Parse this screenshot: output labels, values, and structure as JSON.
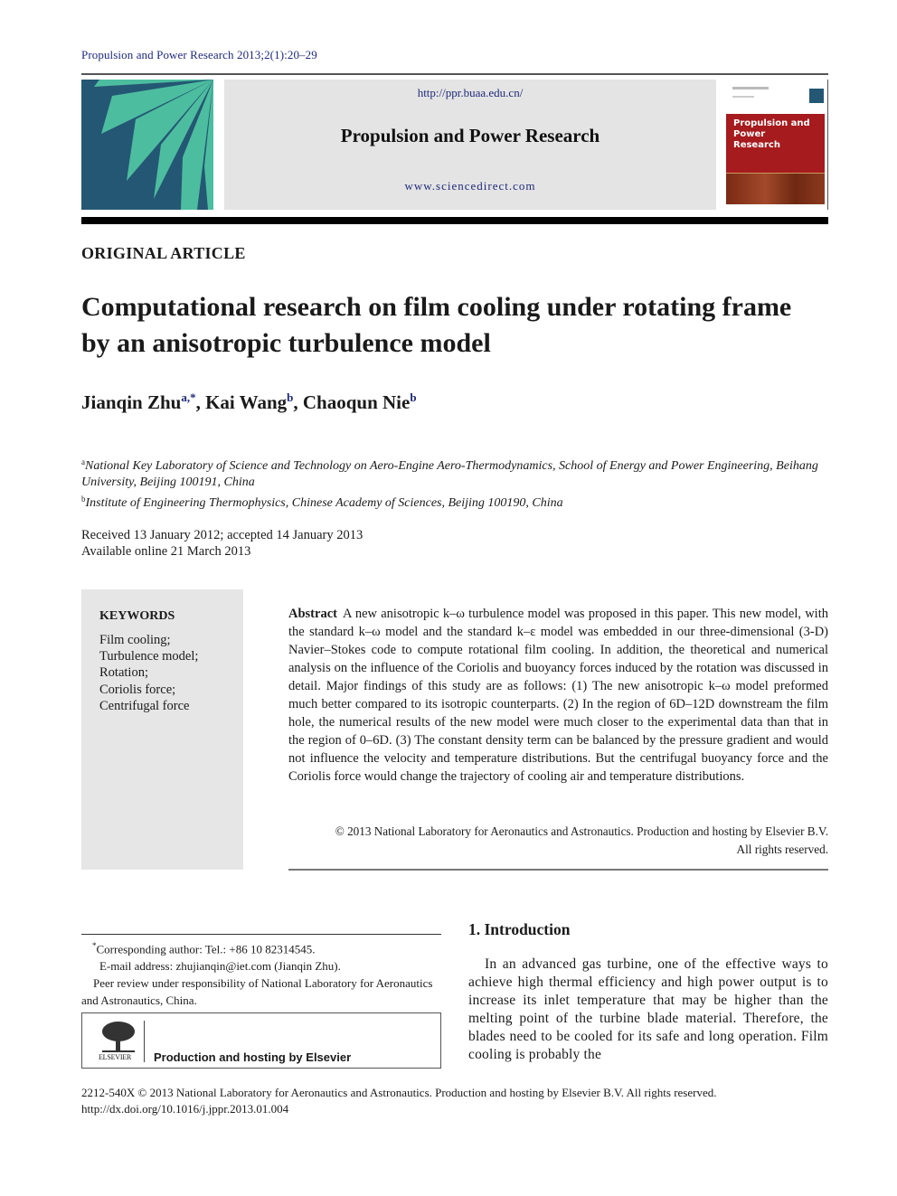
{
  "journal_reference": "Propulsion and Power Research 2013;2(1):20–29",
  "banner": {
    "url_top": "http://ppr.buaa.edu.cn/",
    "journal_name": "Propulsion and Power Research",
    "url_bottom": "www.sciencedirect.com"
  },
  "cover": {
    "title_line1": "Propulsion and",
    "title_line2": "Power",
    "title_line3": "Research",
    "accent_color": "#a61b1e"
  },
  "logo_colors": {
    "background": "#245774",
    "rays": "#4dbd9f"
  },
  "article_type": "ORIGINAL ARTICLE",
  "title": "Computational research on film cooling under rotating frame by an anisotropic turbulence model",
  "authors": [
    {
      "name": "Jianqin Zhu",
      "sup": "a,*",
      "sep": ", "
    },
    {
      "name": "Kai Wang",
      "sup": "b",
      "sep": ", "
    },
    {
      "name": "Chaoqun Nie",
      "sup": "b",
      "sep": ""
    }
  ],
  "affiliations": [
    {
      "mark": "a",
      "text": "National Key Laboratory of Science and Technology on Aero-Engine Aero-Thermodynamics, School of Energy and Power Engineering, Beihang University, Beijing 100191, China"
    },
    {
      "mark": "b",
      "text": "Institute of Engineering Thermophysics, Chinese Academy of Sciences, Beijing 100190, China"
    }
  ],
  "dates": {
    "received": "Received 13 January 2012; accepted 14 January 2013",
    "online": "Available online 21 March 2013"
  },
  "keywords": {
    "heading": "KEYWORDS",
    "items": [
      "Film cooling;",
      "Turbulence model;",
      "Rotation;",
      "Coriolis force;",
      "Centrifugal force"
    ]
  },
  "abstract": {
    "label": "Abstract",
    "text": "A new anisotropic k–ω turbulence model was proposed in this paper. This new model, with the standard k–ω model and the standard k–ε model was embedded in our three-dimensional (3-D) Navier–Stokes code to compute rotational film cooling. In addition, the theoretical and numerical analysis on the influence of the Coriolis and buoyancy forces induced by the rotation was discussed in detail. Major findings of this study are as follows: (1) The new anisotropic k–ω model preformed much better compared to its isotropic counterparts. (2) In the region of 6D–12D downstream the film hole, the numerical results of the new model were much closer to the experimental data than that in the region of 0–6D. (3) The constant density term can be balanced by the pressure gradient and would not influence the velocity and temperature distributions. But the centrifugal buoyancy force and the Coriolis force would change the trajectory of cooling air and temperature distributions.",
    "copyright_line1": "© 2013 National Laboratory for Aeronautics and Astronautics. Production and hosting by Elsevier B.V.",
    "copyright_line2": "All rights reserved."
  },
  "footnotes": {
    "corresponding_mark": "*",
    "corresponding": "Corresponding author: Tel.: +86 10 82314545.",
    "email": "E-mail address: zhujianqin@iet.com (Jianqin Zhu).",
    "peer_review": "Peer review under responsibility of National Laboratory for Aeronautics and Astronautics, China."
  },
  "elsevier": {
    "wordmark": "ELSEVIER",
    "text": "Production and hosting by Elsevier"
  },
  "section": {
    "heading": "1.  Introduction",
    "text": "In an advanced gas turbine, one of the effective ways to achieve high thermal efficiency and high power output is to increase its inlet temperature that may be higher than the melting point of the turbine blade material. Therefore, the blades need to be cooled for its safe and long operation. Film cooling is probably the"
  },
  "footer": {
    "issn_line": "2212-540X © 2013 National Laboratory for Aeronautics and Astronautics. Production and hosting by Elsevier B.V. All rights reserved.",
    "doi": "http://dx.doi.org/10.1016/j.jppr.2013.01.004"
  }
}
